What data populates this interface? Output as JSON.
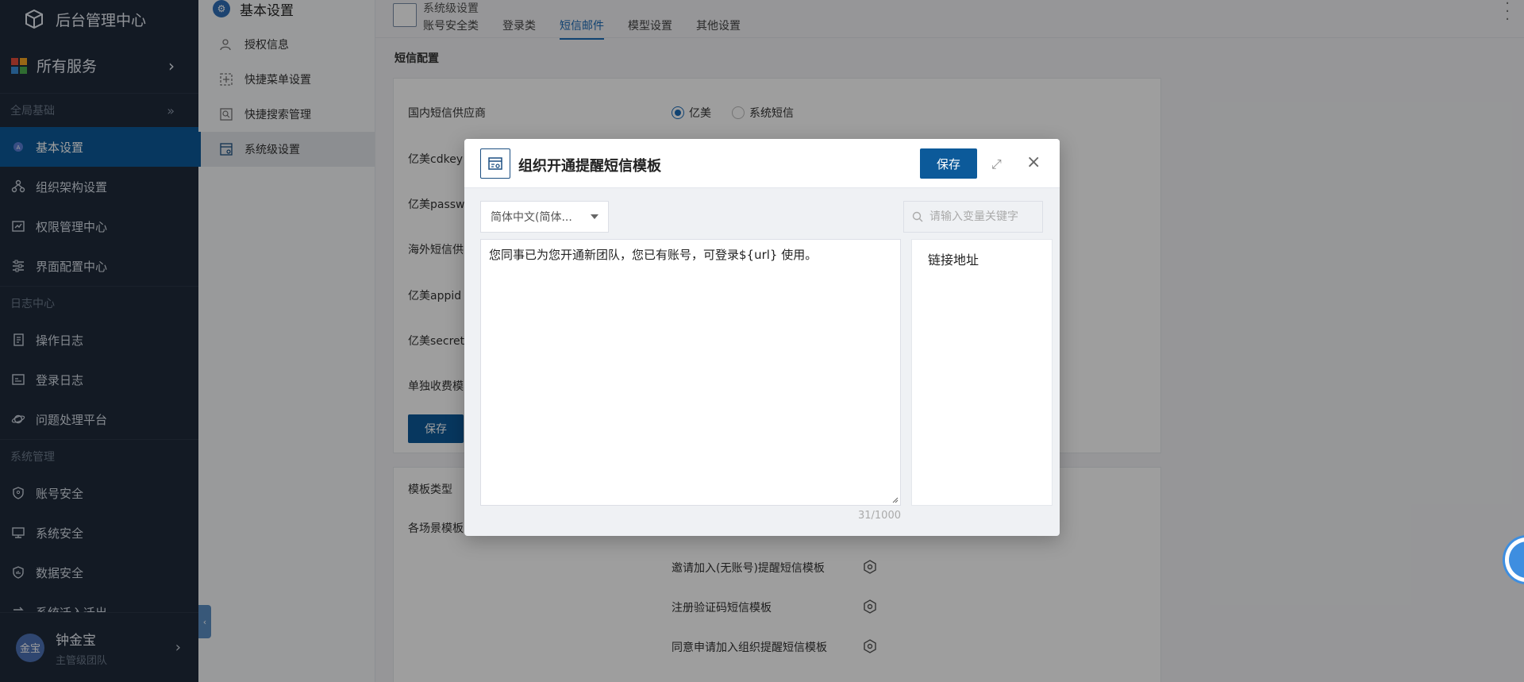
{
  "sidebar": {
    "brand": "后台管理中心",
    "all_services": "所有服务",
    "groups": [
      {
        "title": "全局基础",
        "items": [
          "基本设置",
          "组织架构设置",
          "权限管理中心",
          "界面配置中心"
        ]
      },
      {
        "title": "日志中心",
        "items": [
          "操作日志",
          "登录日志",
          "问题处理平台"
        ]
      },
      {
        "title": "系统管理",
        "items": [
          "账号安全",
          "系统安全",
          "数据安全",
          "系统迁入迁出"
        ]
      }
    ],
    "active_item": "基本设置",
    "user": {
      "avatar_text": "金宝",
      "name": "钟金宝",
      "role": "主管级团队"
    }
  },
  "submenu": {
    "title": "基本设置",
    "items": [
      "授权信息",
      "快捷菜单设置",
      "快捷搜索管理",
      "系统级设置"
    ],
    "active": "系统级设置"
  },
  "main": {
    "breadcrumb": "系统级设置",
    "tabs": [
      "账号安全类",
      "登录类",
      "短信邮件",
      "模型设置",
      "其他设置"
    ],
    "active_tab": "短信邮件",
    "section_title": "短信配置",
    "form": {
      "provider_label": "国内短信供应商",
      "provider_options": [
        "亿美",
        "系统短信"
      ],
      "provider_selected": "亿美",
      "rows": [
        "亿美cdkey",
        "亿美passw",
        "海外短信供",
        "亿美appid",
        "亿美secret",
        "单独收费模"
      ],
      "save": "保存"
    },
    "template_section": {
      "type_label": "模板类型",
      "scene_label": "各场景模板",
      "templates": [
        "邀请加入(无账号)提醒短信模板",
        "注册验证码短信模板",
        "同意申请加入组织提醒短信模板"
      ]
    }
  },
  "modal": {
    "title": "组织开通提醒短信模板",
    "save": "保存",
    "language": "简体中文(简体...",
    "search_placeholder": "请输入变量关键字",
    "content": "您同事已为您开通新团队，您已有账号，可登录${url} 使用。",
    "counter": "31/1000",
    "variables": [
      "链接地址"
    ]
  },
  "colors": {
    "sidebar_bg": "#1f2a3a",
    "primary": "#0c5a9a",
    "active_tab": "#1c6cb8"
  }
}
